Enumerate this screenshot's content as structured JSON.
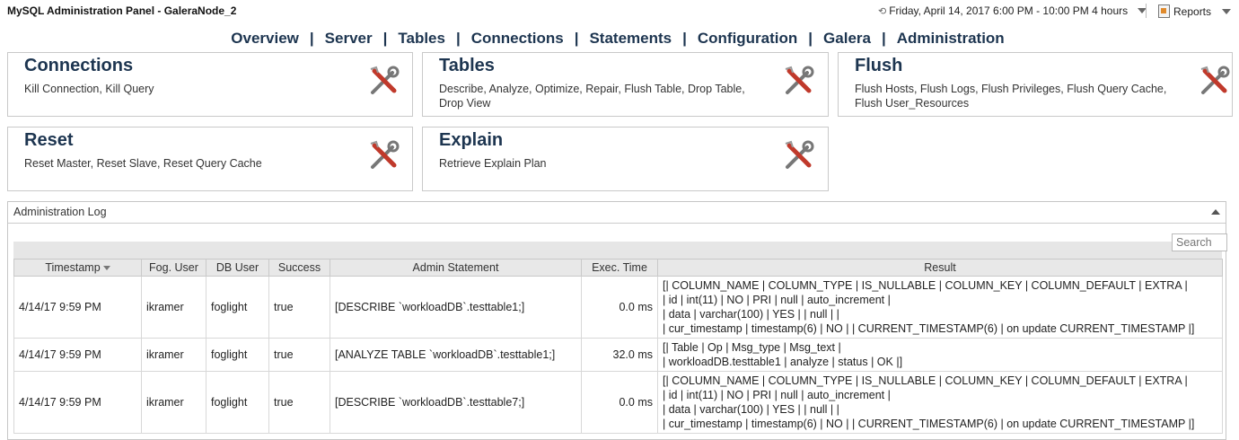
{
  "app": {
    "title": "MySQL Administration Panel - GaleraNode_2",
    "time_range": "Friday, April 14, 2017 6:00 PM - 10:00 PM 4 hours",
    "reports_label": "Reports"
  },
  "nav": {
    "items": [
      "Overview",
      "Server",
      "Tables",
      "Connections",
      "Statements",
      "Configuration",
      "Galera",
      "Administration"
    ],
    "separator": "|"
  },
  "cards": {
    "connections": {
      "title": "Connections",
      "description": "Kill Connection, Kill Query"
    },
    "tables": {
      "title": "Tables",
      "description": "Describe, Analyze, Optimize, Repair, Flush Table, Drop Table, Drop View"
    },
    "flush": {
      "title": "Flush",
      "description": "Flush Hosts, Flush Logs, Flush Privileges, Flush Query Cache, Flush User_Resources"
    },
    "reset": {
      "title": "Reset",
      "description": "Reset Master, Reset Slave, Reset Query Cache"
    },
    "explain": {
      "title": "Explain",
      "description": "Retrieve Explain Plan"
    }
  },
  "log": {
    "title": "Administration Log",
    "search_placeholder": "Search",
    "columns": [
      "Timestamp",
      "Fog. User",
      "DB User",
      "Success",
      "Admin Statement",
      "Exec. Time",
      "Result"
    ],
    "rows": [
      {
        "timestamp": "4/14/17 9:59 PM",
        "fog_user": "ikramer",
        "db_user": "foglight",
        "success": "true",
        "statement": "[DESCRIBE `workloadDB`.testtable1;]",
        "exec_time": "0.0 ms",
        "result": "[| COLUMN_NAME | COLUMN_TYPE | IS_NULLABLE | COLUMN_KEY | COLUMN_DEFAULT | EXTRA |\n| id | int(11) | NO | PRI | null | auto_increment |\n| data | varchar(100) | YES | | null | |\n| cur_timestamp | timestamp(6) | NO | | CURRENT_TIMESTAMP(6) | on update CURRENT_TIMESTAMP |]"
      },
      {
        "timestamp": "4/14/17 9:59 PM",
        "fog_user": "ikramer",
        "db_user": "foglight",
        "success": "true",
        "statement": "[ANALYZE TABLE `workloadDB`.testtable1;]",
        "exec_time": "32.0 ms",
        "result": "[| Table | Op | Msg_type | Msg_text |\n| workloadDB.testtable1 | analyze | status | OK |]"
      },
      {
        "timestamp": "4/14/17 9:59 PM",
        "fog_user": "ikramer",
        "db_user": "foglight",
        "success": "true",
        "statement": "[DESCRIBE `workloadDB`.testtable7;]",
        "exec_time": "0.0 ms",
        "result": "[| COLUMN_NAME | COLUMN_TYPE | IS_NULLABLE | COLUMN_KEY | COLUMN_DEFAULT | EXTRA |\n| id | int(11) | NO | PRI | null | auto_increment |\n| data | varchar(100) | YES | | null | |\n| cur_timestamp | timestamp(6) | NO | | CURRENT_TIMESTAMP(6) | on update CURRENT_TIMESTAMP |]"
      }
    ]
  }
}
